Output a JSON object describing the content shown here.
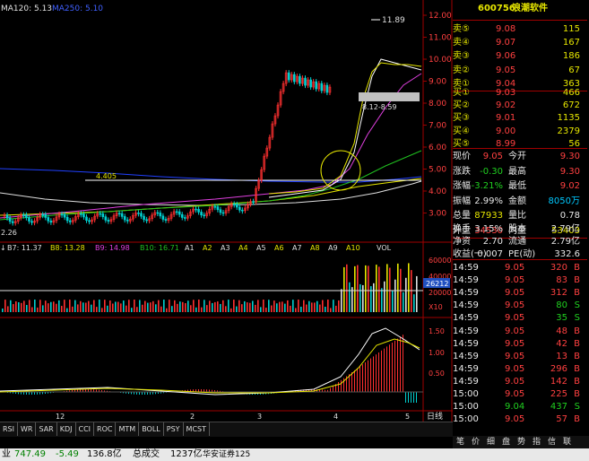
{
  "chart": {
    "ma120_label": "MA120: 5.13",
    "ma250_label": "MA250: 5.10",
    "price_ticks": [
      "12.00",
      "11.00",
      "10.00",
      "9.00",
      "8.00",
      "7.00",
      "6.00",
      "5.00",
      "4.00",
      "3.00"
    ],
    "high_label": "11.89",
    "range_label": "8.12-8.59",
    "level_label": "4.405",
    "low_label": "2.26",
    "bottom_axis": [
      "12",
      "2",
      "3",
      "4",
      "5"
    ],
    "day_label": "日线",
    "ma_legend": [
      "B7: 11.37",
      "B8: 13.28",
      "B9: 14.98",
      "B10: 16.71"
    ],
    "a_legend": [
      "A1",
      "A2",
      "A3",
      "A4",
      "A5",
      "A6",
      "A7",
      "A8",
      "A9",
      "A10"
    ],
    "vol_label": "VOL",
    "vol_ticks": [
      "60000",
      "40000",
      "20000",
      "X10"
    ],
    "vol_value": "26212",
    "macd_ticks": [
      "1.50",
      "1.00",
      "0.50"
    ]
  },
  "panel": {
    "code": "600756",
    "name": "浪潮软件",
    "sell": [
      {
        "label": "卖⑤",
        "price": "9.08",
        "vol": "115"
      },
      {
        "label": "卖④",
        "price": "9.07",
        "vol": "167"
      },
      {
        "label": "卖③",
        "price": "9.06",
        "vol": "186"
      },
      {
        "label": "卖②",
        "price": "9.05",
        "vol": "67"
      },
      {
        "label": "卖①",
        "price": "9.04",
        "vol": "363"
      }
    ],
    "buy": [
      {
        "label": "买①",
        "price": "9.03",
        "vol": "466"
      },
      {
        "label": "买②",
        "price": "9.02",
        "vol": "672"
      },
      {
        "label": "买③",
        "price": "9.01",
        "vol": "1135"
      },
      {
        "label": "买④",
        "price": "9.00",
        "vol": "2379"
      },
      {
        "label": "买⑤",
        "price": "8.99",
        "vol": "56"
      }
    ],
    "stats": [
      {
        "l1": "现价",
        "v1": "9.05",
        "l2": "今开",
        "v2": "9.30"
      },
      {
        "l1": "涨跌",
        "v1": "-0.30",
        "l2": "最高",
        "v2": "9.30"
      },
      {
        "l1": "涨幅",
        "v1": "-3.21%",
        "l2": "最低",
        "v2": "9.02"
      },
      {
        "l1": "振幅",
        "v1": "2.99%",
        "l2": "金额",
        "v2": "8050万"
      },
      {
        "l1": "总量",
        "v1": "87933",
        "l2": "量比",
        "v2": "0.78"
      },
      {
        "l1": "外盘",
        "v1": "34530",
        "l2": "内盘",
        "v2": "53403"
      }
    ],
    "stats2": [
      {
        "l1": "换手",
        "v1": "3.15%",
        "l2": "股本",
        "v2": "2.79亿"
      },
      {
        "l1": "净资",
        "v1": "2.70",
        "l2": "流通",
        "v2": "2.79亿"
      },
      {
        "l1": "收益(一)",
        "v1": "0.007",
        "l2": "PE(动)",
        "v2": "332.6"
      }
    ],
    "ticks": [
      {
        "t": "14:59",
        "p": "9.05",
        "v": "320",
        "s": "B"
      },
      {
        "t": "14:59",
        "p": "9.05",
        "v": "83",
        "s": "B"
      },
      {
        "t": "14:59",
        "p": "9.05",
        "v": "312",
        "s": "B"
      },
      {
        "t": "14:59",
        "p": "9.05",
        "v": "80",
        "s": "S"
      },
      {
        "t": "14:59",
        "p": "9.05",
        "v": "35",
        "s": "S"
      },
      {
        "t": "14:59",
        "p": "9.05",
        "v": "48",
        "s": "B"
      },
      {
        "t": "14:59",
        "p": "9.05",
        "v": "42",
        "s": "B"
      },
      {
        "t": "14:59",
        "p": "9.05",
        "v": "13",
        "s": "B"
      },
      {
        "t": "14:59",
        "p": "9.05",
        "v": "296",
        "s": "B"
      },
      {
        "t": "14:59",
        "p": "9.05",
        "v": "142",
        "s": "B"
      },
      {
        "t": "15:00",
        "p": "9.05",
        "v": "225",
        "s": "B"
      },
      {
        "t": "15:00",
        "p": "9.04",
        "v": "437",
        "s": "S"
      },
      {
        "t": "15:00",
        "p": "9.05",
        "v": "57",
        "s": "B"
      }
    ]
  },
  "indicator_tabs": [
    "RSI",
    "WR",
    "SAR",
    "KDJ",
    "CCI",
    "ROC",
    "MTM",
    "BOLL",
    "PSY",
    "MCST"
  ],
  "side_tabs": [
    "笔",
    "价",
    "细",
    "盘",
    "势",
    "指",
    "信",
    "联"
  ],
  "status": {
    "left": "业",
    "index_value": "747.49",
    "index_change": "-5.49",
    "index_amount": "136.8亿",
    "total_label": "总成交",
    "total_value": "1237亿",
    "broker": "华安证券125"
  }
}
